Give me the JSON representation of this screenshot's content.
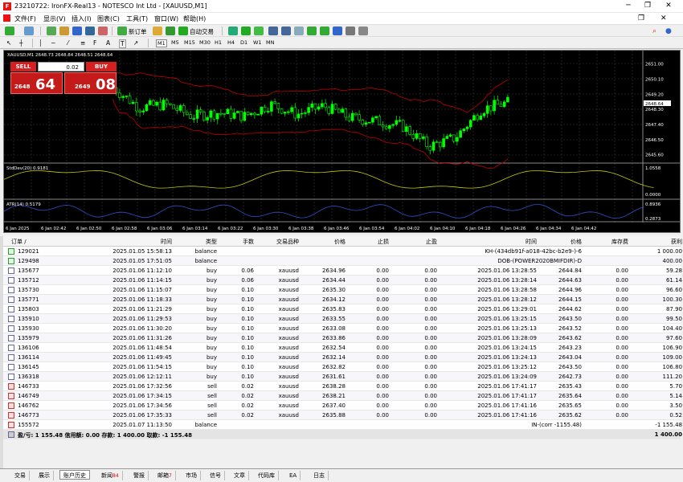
{
  "window": {
    "title": "23210722: IronFX-Real13 - NOTESCO Int Ltd - [XAUUSD,M1]",
    "min": "─",
    "max": "❐",
    "close": "✕"
  },
  "menu": [
    "文件(F)",
    "显示(V)",
    "插入(I)",
    "图表(C)",
    "工具(T)",
    "窗口(W)",
    "帮助(H)"
  ],
  "toolbar": {
    "new_order": "新订单",
    "autotrade": "自动交易",
    "timeframes": [
      "M1",
      "M5",
      "M15",
      "M30",
      "H1",
      "H4",
      "D1",
      "W1",
      "MN"
    ]
  },
  "chart": {
    "title": "XAUUSD,M1  2648.73 2648.84 2648.51 2648.64",
    "sell_label": "SELL",
    "buy_label": "BUY",
    "volume": "0.02",
    "sell_small": "2648",
    "sell_big": "64",
    "buy_small": "2649",
    "buy_big": "08",
    "price_labels": [
      "2651.00",
      "2650.10",
      "2649.20",
      "2648.64",
      "2648.30",
      "2647.40",
      "2646.50",
      "2645.60"
    ],
    "stddev_label": "StdDev(20) 0.9181",
    "stddev_scale": [
      "1.0558",
      "0.0000"
    ],
    "atr_label": "ATR(14) 0.5179",
    "atr_scale": [
      "0.8936",
      "0.2873"
    ],
    "time_labels": [
      "6 Jan 2025",
      "6 Jan 02:42",
      "6 Jan 02:50",
      "6 Jan 02:58",
      "6 Jan 03:06",
      "6 Jan 03:14",
      "6 Jan 03:22",
      "6 Jan 03:30",
      "6 Jan 03:38",
      "6 Jan 03:46",
      "6 Jan 03:54",
      "6 Jan 04:02",
      "6 Jan 04:10",
      "6 Jan 04:18",
      "6 Jan 04:26",
      "6 Jan 04:34",
      "6 Jan 04:42"
    ],
    "colors": {
      "bull": "#00ff00",
      "bear": "#000000",
      "band": "#c00000",
      "stddev": "#c8c800",
      "atr": "#3050c8",
      "grid": "#3a3a3a"
    }
  },
  "orders": {
    "headers": [
      "订单 /",
      "时间",
      "类型",
      "手数",
      "交易品种",
      "价格",
      "止损",
      "止盈",
      "时间",
      "价格",
      "库存费",
      "获利"
    ],
    "rows": [
      {
        "k": "bal",
        "c": [
          "129021",
          "2025.01.05 15:58:13",
          "balance",
          "",
          "",
          "",
          "",
          "",
          "",
          "KH-(434db91f-a018-42bc-b2e9-)-6",
          "",
          "1 000.00"
        ]
      },
      {
        "k": "bal",
        "c": [
          "129498",
          "2025.01.05 17:51:05",
          "balance",
          "",
          "",
          "",
          "",
          "",
          "",
          "DOB-(POWER2020BMIFDIR)-D",
          "",
          "400.00"
        ]
      },
      {
        "k": "buy",
        "c": [
          "135677",
          "2025.01.06 11:12:10",
          "buy",
          "0.06",
          "xauusd",
          "2634.96",
          "0.00",
          "0.00",
          "2025.01.06 13:28:55",
          "2644.84",
          "0.00",
          "59.28"
        ]
      },
      {
        "k": "buy",
        "c": [
          "135712",
          "2025.01.06 11:14:15",
          "buy",
          "0.06",
          "xauusd",
          "2634.44",
          "0.00",
          "0.00",
          "2025.01.06 13:28:14",
          "2644.63",
          "0.00",
          "61.14"
        ]
      },
      {
        "k": "buy",
        "c": [
          "135730",
          "2025.01.06 11:15:07",
          "buy",
          "0.10",
          "xauusd",
          "2635.30",
          "0.00",
          "0.00",
          "2025.01.06 13:28:58",
          "2644.96",
          "0.00",
          "96.60"
        ]
      },
      {
        "k": "buy",
        "c": [
          "135771",
          "2025.01.06 11:18:33",
          "buy",
          "0.10",
          "xauusd",
          "2634.12",
          "0.00",
          "0.00",
          "2025.01.06 13:28:12",
          "2644.15",
          "0.00",
          "100.30"
        ]
      },
      {
        "k": "buy",
        "c": [
          "135803",
          "2025.01.06 11:21:29",
          "buy",
          "0.10",
          "xauusd",
          "2635.83",
          "0.00",
          "0.00",
          "2025.01.06 13:29:01",
          "2644.62",
          "0.00",
          "87.90"
        ]
      },
      {
        "k": "buy",
        "c": [
          "135910",
          "2025.01.06 11:29:53",
          "buy",
          "0.10",
          "xauusd",
          "2633.55",
          "0.00",
          "0.00",
          "2025.01.06 13:25:15",
          "2643.50",
          "0.00",
          "99.50"
        ]
      },
      {
        "k": "buy",
        "c": [
          "135930",
          "2025.01.06 11:30:20",
          "buy",
          "0.10",
          "xauusd",
          "2633.08",
          "0.00",
          "0.00",
          "2025.01.06 13:25:13",
          "2643.52",
          "0.00",
          "104.40"
        ]
      },
      {
        "k": "buy",
        "c": [
          "135979",
          "2025.01.06 11:31:26",
          "buy",
          "0.10",
          "xauusd",
          "2633.86",
          "0.00",
          "0.00",
          "2025.01.06 13:28:09",
          "2643.62",
          "0.00",
          "97.60"
        ]
      },
      {
        "k": "buy",
        "c": [
          "136106",
          "2025.01.06 11:48:54",
          "buy",
          "0.10",
          "xauusd",
          "2632.54",
          "0.00",
          "0.00",
          "2025.01.06 13:24:15",
          "2643.23",
          "0.00",
          "106.90"
        ]
      },
      {
        "k": "buy",
        "c": [
          "136114",
          "2025.01.06 11:49:45",
          "buy",
          "0.10",
          "xauusd",
          "2632.14",
          "0.00",
          "0.00",
          "2025.01.06 13:24:13",
          "2643.04",
          "0.00",
          "109.00"
        ]
      },
      {
        "k": "buy",
        "c": [
          "136145",
          "2025.01.06 11:54:15",
          "buy",
          "0.10",
          "xauusd",
          "2632.82",
          "0.00",
          "0.00",
          "2025.01.06 13:25:12",
          "2643.50",
          "0.00",
          "106.80"
        ]
      },
      {
        "k": "buy",
        "c": [
          "136318",
          "2025.01.06 12:12:11",
          "buy",
          "0.10",
          "xauusd",
          "2631.61",
          "0.00",
          "0.00",
          "2025.01.06 13:24:09",
          "2642.73",
          "0.00",
          "111.20"
        ]
      },
      {
        "k": "sell",
        "c": [
          "146733",
          "2025.01.06 17:32:56",
          "sell",
          "0.02",
          "xauusd",
          "2638.28",
          "0.00",
          "0.00",
          "2025.01.06 17:41:17",
          "2635.43",
          "0.00",
          "5.70"
        ]
      },
      {
        "k": "sell",
        "c": [
          "146749",
          "2025.01.06 17:34:15",
          "sell",
          "0.02",
          "xauusd",
          "2638.21",
          "0.00",
          "0.00",
          "2025.01.06 17:41:17",
          "2635.64",
          "0.00",
          "5.14"
        ]
      },
      {
        "k": "sell",
        "c": [
          "146762",
          "2025.01.06 17:34:56",
          "sell",
          "0.02",
          "xauusd",
          "2637.40",
          "0.00",
          "0.00",
          "2025.01.06 17:41:16",
          "2635.65",
          "0.00",
          "3.50"
        ]
      },
      {
        "k": "sell",
        "c": [
          "146773",
          "2025.01.06 17:35:33",
          "sell",
          "0.02",
          "xauusd",
          "2635.88",
          "0.00",
          "0.00",
          "2025.01.06 17:41:16",
          "2635.62",
          "0.00",
          "0.52"
        ]
      },
      {
        "k": "sell",
        "c": [
          "155572",
          "2025.01.07 11:13:50",
          "balance",
          "",
          "",
          "",
          "",
          "",
          "",
          "IN-(corr -1155.48)",
          "",
          "-1 155.48"
        ]
      }
    ],
    "summary": {
      "label": "盈/亏: 1 155.48  信用额: 0.00  存款: 1 400.00  取款: -1 155.48",
      "total": "1 400.00"
    }
  },
  "tabs": [
    {
      "label": "交易"
    },
    {
      "label": "展示"
    },
    {
      "label": "账户历史",
      "active": true
    },
    {
      "label": "新闻",
      "count": "84"
    },
    {
      "label": "警报"
    },
    {
      "label": "邮箱",
      "count": "7"
    },
    {
      "label": "市场"
    },
    {
      "label": "信号"
    },
    {
      "label": "文章"
    },
    {
      "label": "代码库"
    },
    {
      "label": "EA"
    },
    {
      "label": "日志"
    }
  ]
}
